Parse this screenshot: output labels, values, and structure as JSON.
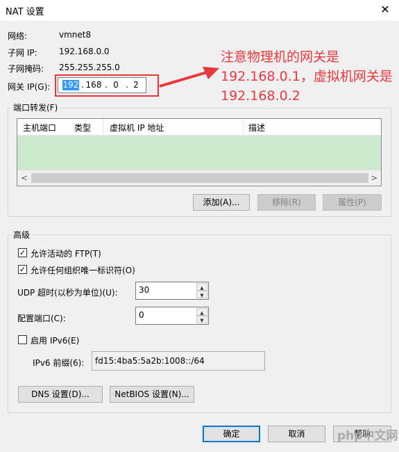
{
  "window": {
    "title": "NAT 设置",
    "close_glyph": "✕"
  },
  "info": {
    "network_label": "网络:",
    "network_value": "vmnet8",
    "subnet_ip_label": "子网 IP:",
    "subnet_ip_value": "192.168.0.0",
    "subnet_mask_label": "子网掩码:",
    "subnet_mask_value": "255.255.255.0",
    "gateway_label": "网关 IP(G):",
    "gateway_octets": [
      "192",
      "168",
      "0",
      "2"
    ]
  },
  "annotation": {
    "text": "注意物理机的网关是192.168.0.1，虚拟机网关是192.168.0.2",
    "color": "#e8383d"
  },
  "port_forwarding": {
    "group_title": "端口转发(F)",
    "columns": [
      "主机端口",
      "类型",
      "虚拟机 IP 地址",
      "描述"
    ],
    "scroll_left": "<",
    "scroll_right": ">",
    "buttons": {
      "add": "添加(A)...",
      "remove": "移除(R)",
      "properties": "属性(P)"
    }
  },
  "advanced": {
    "group_title": "高级",
    "allow_ftp": {
      "label": "允许活动的 FTP(T)",
      "checked": true
    },
    "allow_oui": {
      "label": "允许任何组织唯一标识符(O)",
      "checked": true
    },
    "udp_timeout": {
      "label": "UDP 超时(以秒为单位)(U):",
      "value": "30"
    },
    "config_port": {
      "label": "配置端口(C):",
      "value": "0"
    },
    "enable_ipv6": {
      "label": "启用 IPv6(E)",
      "checked": false
    },
    "ipv6_prefix": {
      "label": "IPv6 前缀(6):",
      "value": "fd15:4ba5:5a2b:1008::/64"
    },
    "dns_button": "DNS 设置(D)...",
    "netbios_button": "NetBIOS 设置(N)..."
  },
  "footer": {
    "ok": "确定",
    "cancel": "取消",
    "help": "帮助"
  },
  "watermark": "php中文网",
  "colors": {
    "selection": "#3399ff",
    "table_row": "#cce8cf",
    "default_button_border": "#0078d7"
  }
}
